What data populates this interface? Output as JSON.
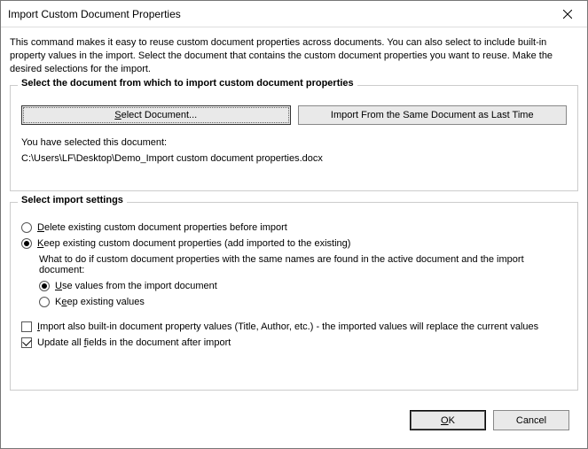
{
  "window": {
    "title": "Import Custom Document Properties"
  },
  "intro": "This command makes it easy to reuse custom document properties across documents. You can also select to include built-in property values in the import. Select the document that contains the custom document properties you want to reuse. Make the desired selections for the import.",
  "group1": {
    "legend": "Select the document from which to import custom document properties",
    "btn_select": "Select Document...",
    "btn_last": "Import From the Same Document as Last Time",
    "status": "You have selected this document:",
    "path": "C:\\Users\\LF\\Desktop\\Demo_Import custom document properties.docx"
  },
  "group2": {
    "legend": "Select import settings",
    "opt_delete_pre": "",
    "opt_delete": "Delete existing custom document properties before import",
    "opt_keep": "Keep existing custom document properties (add imported to the existing)",
    "desc_conflict": "What to do if custom document properties with the same names are found in the active document and the import document:",
    "opt_use_import": "Use values from the import document",
    "opt_keep_existing": "Keep existing values",
    "chk_builtin": "Import also built-in document property values (Title, Author, etc.) - the imported values will replace the current values",
    "chk_update": "Update all fields in the document after import"
  },
  "footer": {
    "ok": "OK",
    "cancel": "Cancel"
  }
}
